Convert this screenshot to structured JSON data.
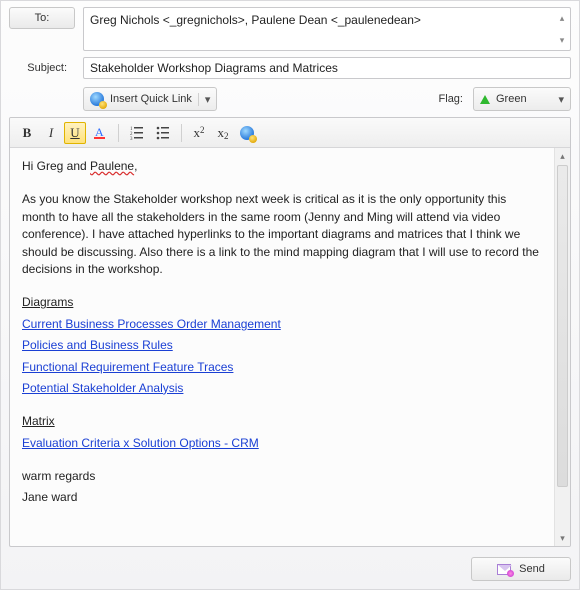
{
  "labels": {
    "to_button": "To:",
    "subject": "Subject:",
    "flag": "Flag:"
  },
  "to_value": "Greg Nichols <_gregnichols>, Paulene Dean <_paulenedean>",
  "subject_value": "Stakeholder Workshop Diagrams and Matrices",
  "quicklink": {
    "label": "Insert Quick Link"
  },
  "flag_select": {
    "value": "Green",
    "color": "#2eb82e"
  },
  "format_buttons": {
    "bold": "B",
    "italic": "I",
    "underline": "U",
    "sup_x": "x",
    "sup_exp": "2",
    "sub_x": "x",
    "sub_exp": "2"
  },
  "body": {
    "greeting_pre": "Hi Greg and ",
    "greeting_misspelled": "Paulene",
    "greeting_post": ",",
    "para1": "As you know the Stakeholder workshop next week is critical as it is the only opportunity this month to have all the stakeholders in the same room (Jenny and Ming will attend via video conference). I have attached hyperlinks to the important diagrams and matrices that I think we should be discussing. Also there is a link to the mind mapping diagram that I will use to record the decisions in the workshop.",
    "diagrams_head": "Diagrams",
    "diagram_links": [
      "Current Business Processes Order Management",
      "Policies and Business Rules",
      "Functional Requirement Feature Traces",
      "Potential Stakeholder Analysis"
    ],
    "matrix_head": "Matrix",
    "matrix_links": [
      "Evaluation Criteria x Solution Options - CRM"
    ],
    "signoff1": "warm regards",
    "signoff2": "Jane ward"
  },
  "send_label": "Send"
}
